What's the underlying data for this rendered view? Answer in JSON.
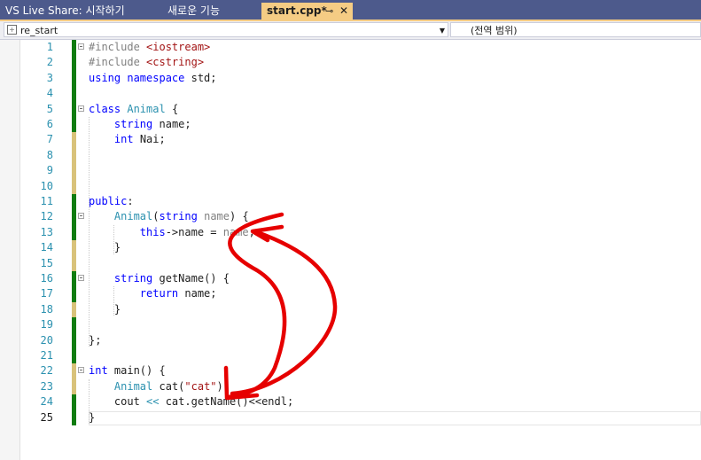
{
  "tabs": [
    {
      "label": "VS Live Share: 시작하기",
      "state": "inactive"
    },
    {
      "label": "새로운 기능",
      "state": "inactive"
    },
    {
      "label": "start.cpp*",
      "state": "active",
      "pin_icon": "pin-icon",
      "close_icon": "close-icon"
    }
  ],
  "pin_glyph": "⊸",
  "close_glyph": "✕",
  "navbar": {
    "project": "re_start",
    "scope": "(전역 범위)",
    "dropdown_glyph": "▼"
  },
  "colors": {
    "titlebar": "#4d5a8c",
    "active_tab": "#f5cc84",
    "keyword": "#0000ff",
    "type": "#2b91af",
    "string": "#a31515",
    "line_number": "#2b91af",
    "saved_change": "#107c10",
    "unsaved_change": "#d9c27a",
    "annotation": "#e60000"
  },
  "editor": {
    "current_line": 25,
    "lines": [
      {
        "num": "1",
        "change": "saved",
        "fold": true,
        "tokens": [
          {
            "c": "pp",
            "t": "#include "
          },
          {
            "c": "str",
            "t": "<iostream>"
          }
        ]
      },
      {
        "num": "2",
        "change": "saved",
        "fold": false,
        "tokens": [
          {
            "c": "pp",
            "t": "#include "
          },
          {
            "c": "str",
            "t": "<cstring>"
          }
        ]
      },
      {
        "num": "3",
        "change": "saved",
        "fold": false,
        "tokens": [
          {
            "c": "kw",
            "t": "using namespace"
          },
          {
            "c": "",
            "t": " std;"
          }
        ]
      },
      {
        "num": "4",
        "change": "saved",
        "fold": false,
        "tokens": []
      },
      {
        "num": "5",
        "change": "saved",
        "fold": true,
        "tokens": [
          {
            "c": "kw",
            "t": "class"
          },
          {
            "c": "",
            "t": " "
          },
          {
            "c": "ty",
            "t": "Animal"
          },
          {
            "c": "",
            "t": " {"
          }
        ]
      },
      {
        "num": "6",
        "change": "saved",
        "fold": false,
        "tokens": [
          {
            "c": "",
            "t": "    "
          },
          {
            "c": "kw",
            "t": "string"
          },
          {
            "c": "",
            "t": " name;"
          }
        ]
      },
      {
        "num": "7",
        "change": "unsaved",
        "fold": false,
        "tokens": [
          {
            "c": "",
            "t": "    "
          },
          {
            "c": "kw",
            "t": "int"
          },
          {
            "c": "",
            "t": " Nai;"
          }
        ]
      },
      {
        "num": "8",
        "change": "unsaved",
        "fold": false,
        "tokens": []
      },
      {
        "num": "9",
        "change": "unsaved",
        "fold": false,
        "tokens": []
      },
      {
        "num": "10",
        "change": "unsaved",
        "fold": false,
        "tokens": []
      },
      {
        "num": "11",
        "change": "saved",
        "fold": false,
        "tokens": [
          {
            "c": "kw",
            "t": "public"
          },
          {
            "c": "",
            "t": ":"
          }
        ]
      },
      {
        "num": "12",
        "change": "saved",
        "fold": true,
        "tokens": [
          {
            "c": "",
            "t": "    "
          },
          {
            "c": "ty",
            "t": "Animal"
          },
          {
            "c": "",
            "t": "("
          },
          {
            "c": "kw",
            "t": "string"
          },
          {
            "c": "",
            "t": " "
          },
          {
            "c": "par",
            "t": "name"
          },
          {
            "c": "",
            "t": ") {"
          }
        ]
      },
      {
        "num": "13",
        "change": "saved",
        "fold": false,
        "tokens": [
          {
            "c": "",
            "t": "        "
          },
          {
            "c": "kw",
            "t": "this"
          },
          {
            "c": "",
            "t": "->name = "
          },
          {
            "c": "par",
            "t": "name"
          },
          {
            "c": "",
            "t": ";"
          }
        ]
      },
      {
        "num": "14",
        "change": "unsaved",
        "fold": false,
        "tokens": [
          {
            "c": "",
            "t": "    }"
          }
        ]
      },
      {
        "num": "15",
        "change": "unsaved",
        "fold": false,
        "tokens": []
      },
      {
        "num": "16",
        "change": "saved",
        "fold": true,
        "tokens": [
          {
            "c": "",
            "t": "    "
          },
          {
            "c": "kw",
            "t": "string"
          },
          {
            "c": "",
            "t": " getName() {"
          }
        ]
      },
      {
        "num": "17",
        "change": "saved",
        "fold": false,
        "tokens": [
          {
            "c": "",
            "t": "        "
          },
          {
            "c": "kw",
            "t": "return"
          },
          {
            "c": "",
            "t": " name;"
          }
        ]
      },
      {
        "num": "18",
        "change": "unsaved",
        "fold": false,
        "tokens": [
          {
            "c": "",
            "t": "    }"
          }
        ]
      },
      {
        "num": "19",
        "change": "saved",
        "fold": false,
        "tokens": []
      },
      {
        "num": "20",
        "change": "saved",
        "fold": false,
        "tokens": [
          {
            "c": "",
            "t": "};"
          }
        ]
      },
      {
        "num": "21",
        "change": "saved",
        "fold": false,
        "tokens": []
      },
      {
        "num": "22",
        "change": "unsaved",
        "fold": true,
        "tokens": [
          {
            "c": "kw",
            "t": "int"
          },
          {
            "c": "",
            "t": " main() {"
          }
        ]
      },
      {
        "num": "23",
        "change": "unsaved",
        "fold": false,
        "tokens": [
          {
            "c": "",
            "t": "    "
          },
          {
            "c": "ty",
            "t": "Animal"
          },
          {
            "c": "",
            "t": " cat("
          },
          {
            "c": "str",
            "t": "\"cat\""
          },
          {
            "c": "",
            "t": ");"
          }
        ]
      },
      {
        "num": "24",
        "change": "saved",
        "fold": false,
        "tokens": [
          {
            "c": "",
            "t": "    cout "
          },
          {
            "c": "ty",
            "t": "<<"
          },
          {
            "c": "",
            "t": " cat.getName()<<endl;"
          }
        ]
      },
      {
        "num": "25",
        "change": "saved",
        "fold": false,
        "tokens": [
          {
            "c": "",
            "t": "}"
          }
        ]
      }
    ]
  },
  "annotation": {
    "type": "hand-drawn-arrows",
    "color": "#e60000"
  }
}
